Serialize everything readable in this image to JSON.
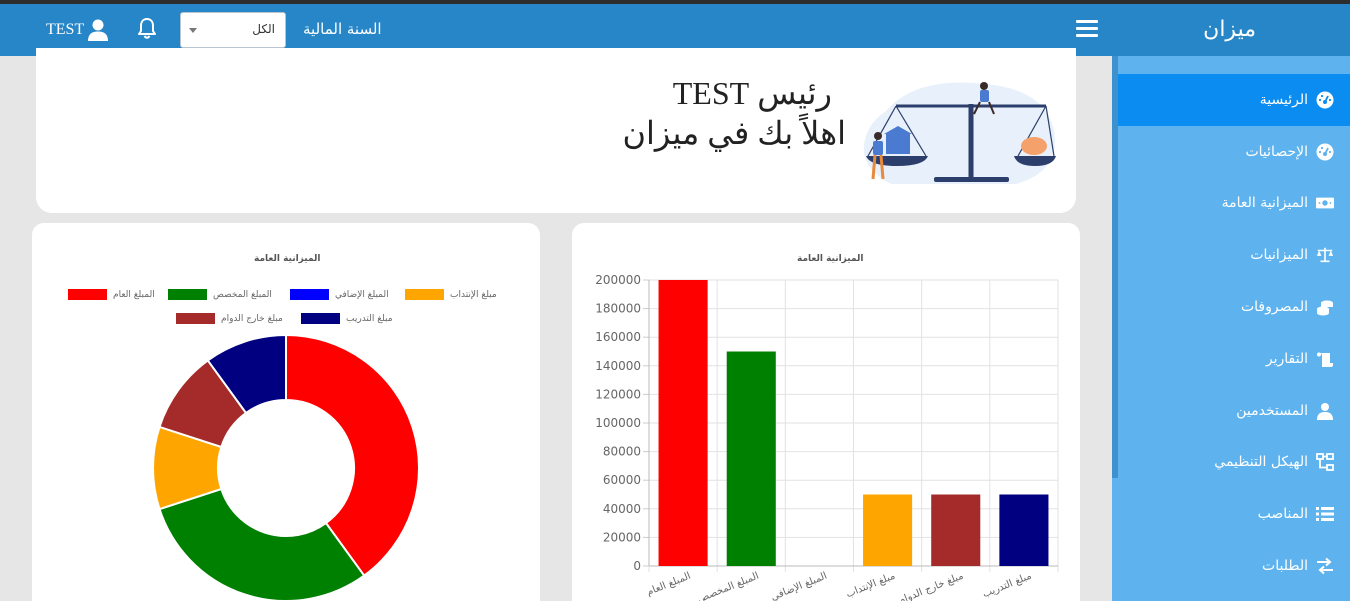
{
  "header": {
    "brand": "ميزان",
    "fiscal_year_label": "السنة المالية",
    "fiscal_year_value": "الكل",
    "username": "TEST"
  },
  "sidebar": {
    "items": [
      {
        "label": "الرئيسية",
        "icon": "gauge-icon",
        "active": true
      },
      {
        "label": "الإحصائيات",
        "icon": "gauge-icon",
        "active": false
      },
      {
        "label": "الميزانية العامة",
        "icon": "money-bill-icon",
        "active": false
      },
      {
        "label": "الميزانيات",
        "icon": "balance-scale-icon",
        "active": false
      },
      {
        "label": "المصروفات",
        "icon": "coins-icon",
        "active": false
      },
      {
        "label": "التقارير",
        "icon": "scroll-icon",
        "active": false
      },
      {
        "label": "المستخدمين",
        "icon": "user-icon",
        "active": false
      },
      {
        "label": "الهيكل التنظيمي",
        "icon": "sitemap-icon",
        "active": false
      },
      {
        "label": "المناصب",
        "icon": "list-icon",
        "active": false
      },
      {
        "label": "الطلبات",
        "icon": "exchange-icon",
        "active": false
      }
    ]
  },
  "welcome": {
    "greeting": "رئيس TEST",
    "message": "اهلاً بك في ميزان"
  },
  "chart_data": [
    {
      "type": "pie",
      "title": "الميزانية العامة",
      "categories": [
        "المبلغ العام",
        "المبلغ المخصص",
        "المبلغ الإضافي",
        "مبلغ الإنتداب",
        "مبلغ خارج الدوام",
        "مبلغ التدريب"
      ],
      "values": [
        200000,
        150000,
        0,
        50000,
        50000,
        50000
      ],
      "colors": [
        "#ff0000",
        "#008000",
        "#0000ff",
        "#ffa500",
        "#a52a2a",
        "#000080"
      ],
      "legend": "top"
    },
    {
      "type": "bar",
      "title": "الميزانية العامة",
      "categories": [
        "المبلغ العام",
        "المبلغ المخصص",
        "المبلغ الإضافي",
        "مبلغ الإنتداب",
        "مبلغ خارج الدوام",
        "مبلغ التدريب"
      ],
      "values": [
        200000,
        150000,
        0,
        50000,
        50000,
        50000
      ],
      "colors": [
        "#ff0000",
        "#008000",
        "#0000ff",
        "#ffa500",
        "#a52a2a",
        "#000080"
      ],
      "ylim": [
        0,
        200000
      ],
      "yticks": [
        0,
        20000,
        40000,
        60000,
        80000,
        100000,
        120000,
        140000,
        160000,
        180000,
        200000
      ],
      "grid": true
    }
  ]
}
